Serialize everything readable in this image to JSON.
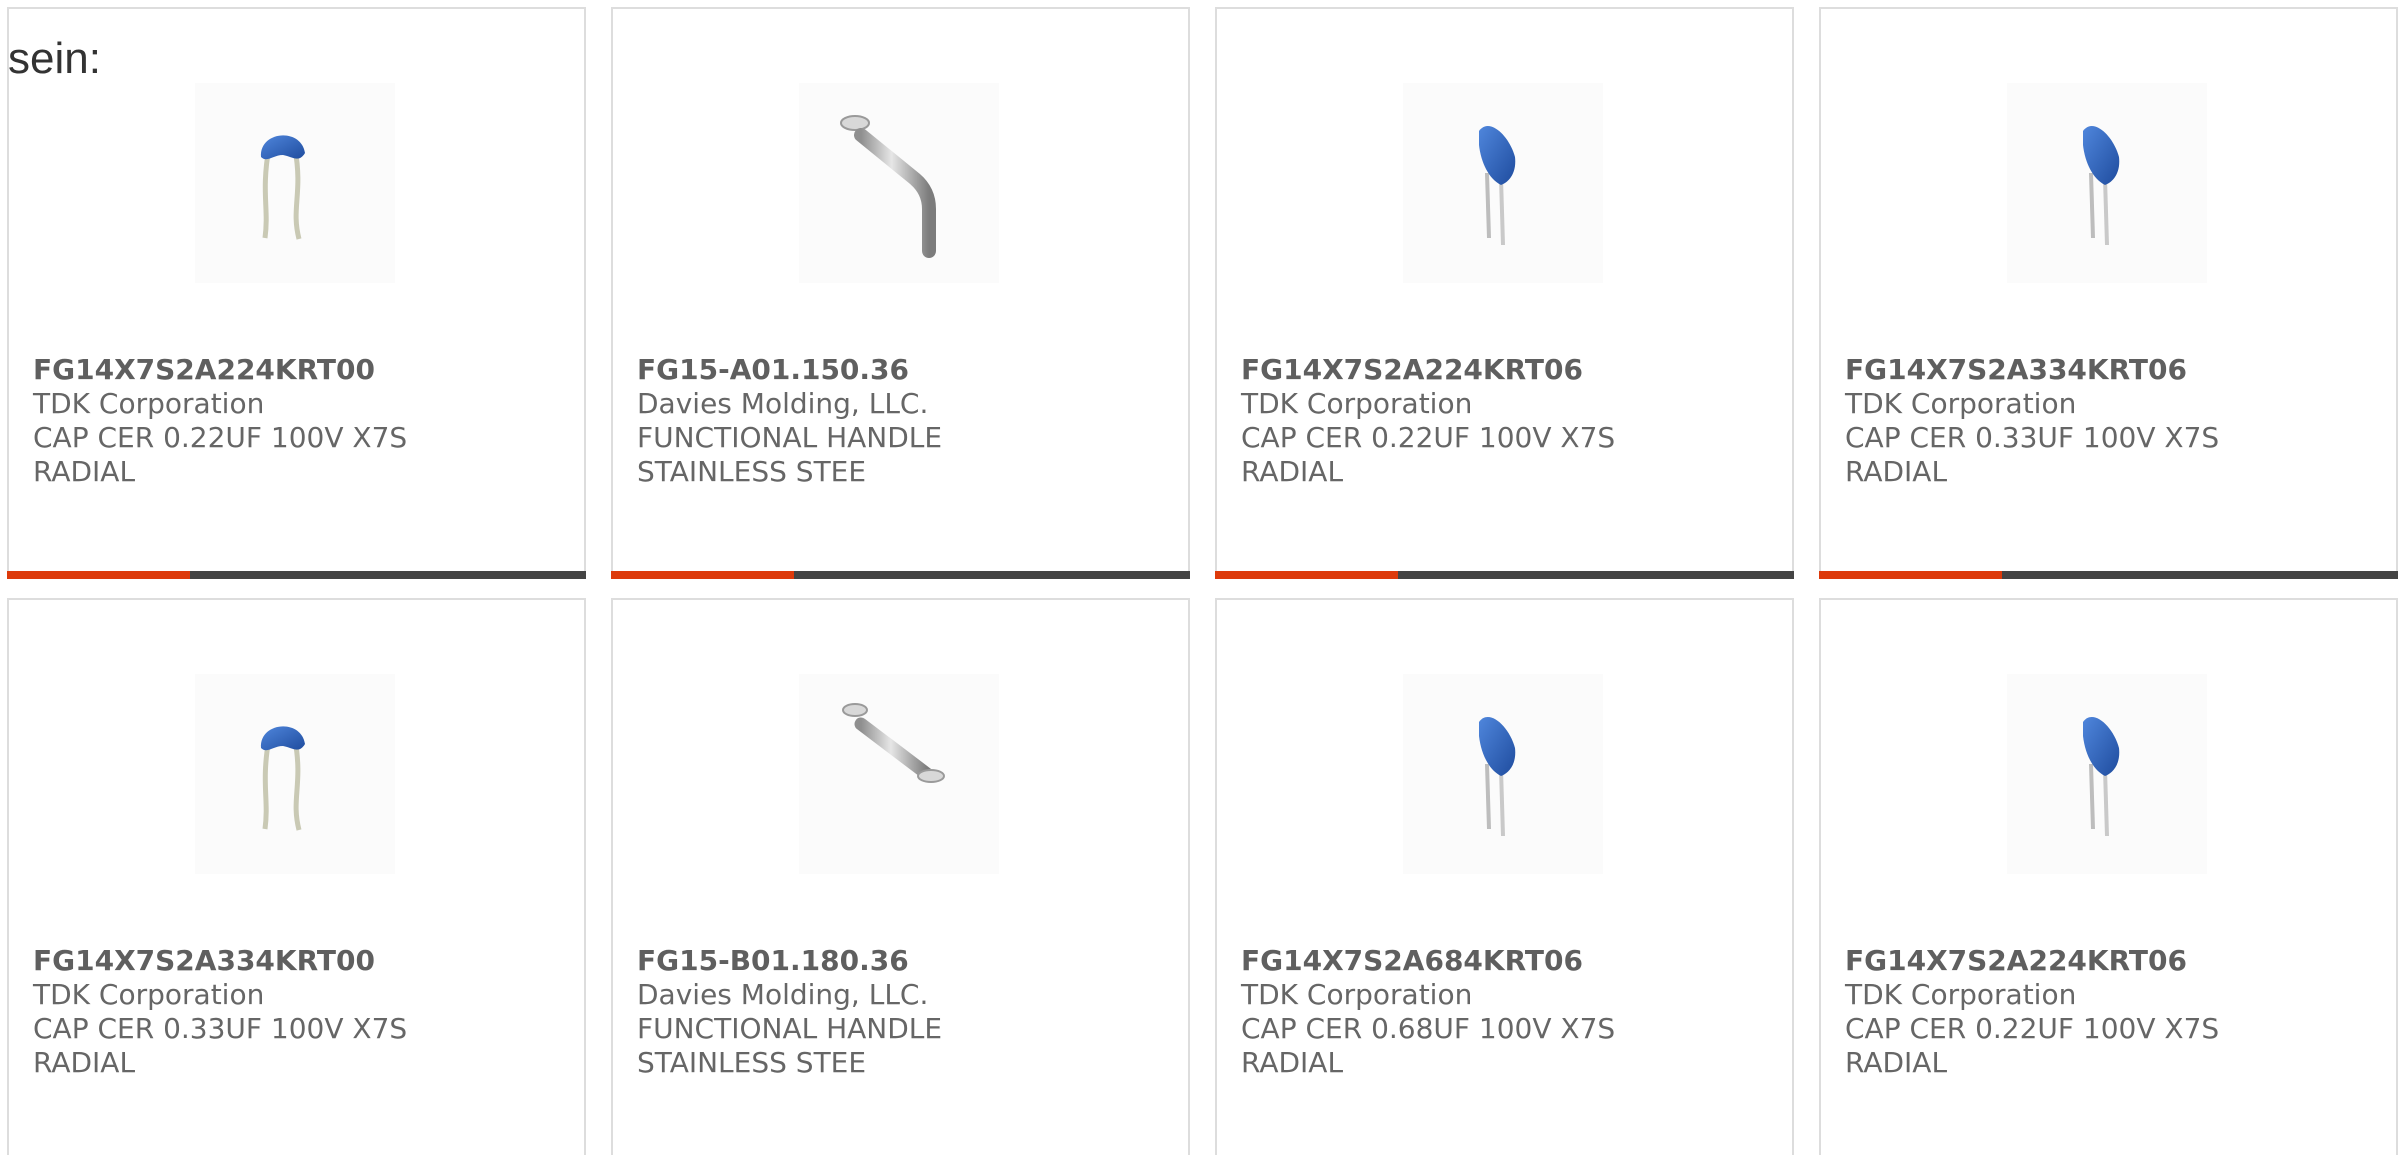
{
  "intro_text": "sein:",
  "products": [
    {
      "part_number": "FG14X7S2A224KRT00",
      "manufacturer": "TDK Corporation",
      "desc_line1": "CAP CER 0.22UF 100V X7S",
      "desc_line2": "RADIAL",
      "image_icon": "blue-disc-capacitor-icon"
    },
    {
      "part_number": "FG15-A01.150.36",
      "manufacturer": "Davies Molding, LLC.",
      "desc_line1": "FUNCTIONAL HANDLE",
      "desc_line2": "STAINLESS STEE",
      "image_icon": "steel-handle-icon"
    },
    {
      "part_number": "FG14X7S2A224KRT06",
      "manufacturer": "TDK Corporation",
      "desc_line1": "CAP CER 0.22UF 100V X7S",
      "desc_line2": "RADIAL",
      "image_icon": "blue-radial-capacitor-icon"
    },
    {
      "part_number": "FG14X7S2A334KRT06",
      "manufacturer": "TDK Corporation",
      "desc_line1": "CAP CER 0.33UF 100V X7S",
      "desc_line2": "RADIAL",
      "image_icon": "blue-radial-capacitor-icon"
    },
    {
      "part_number": "FG14X7S2A334KRT00",
      "manufacturer": "TDK Corporation",
      "desc_line1": "CAP CER 0.33UF 100V X7S",
      "desc_line2": "RADIAL",
      "image_icon": "blue-disc-capacitor-icon"
    },
    {
      "part_number": "FG15-B01.180.36",
      "manufacturer": "Davies Molding, LLC.",
      "desc_line1": "FUNCTIONAL HANDLE",
      "desc_line2": "STAINLESS STEE",
      "image_icon": "steel-handle-icon"
    },
    {
      "part_number": "FG14X7S2A684KRT06",
      "manufacturer": "TDK Corporation",
      "desc_line1": "CAP CER 0.68UF 100V X7S",
      "desc_line2": "RADIAL",
      "image_icon": "blue-radial-capacitor-icon"
    },
    {
      "part_number": "FG14X7S2A224KRT06",
      "manufacturer": "TDK Corporation",
      "desc_line1": "CAP CER 0.22UF 100V X7S",
      "desc_line2": "RADIAL",
      "image_icon": "blue-radial-capacitor-icon"
    }
  ],
  "colors": {
    "accent": "#dd3a0b",
    "bar": "#444444",
    "border": "#dddddd",
    "text": "#666666",
    "capacitor_blue": "#2f62b8"
  }
}
